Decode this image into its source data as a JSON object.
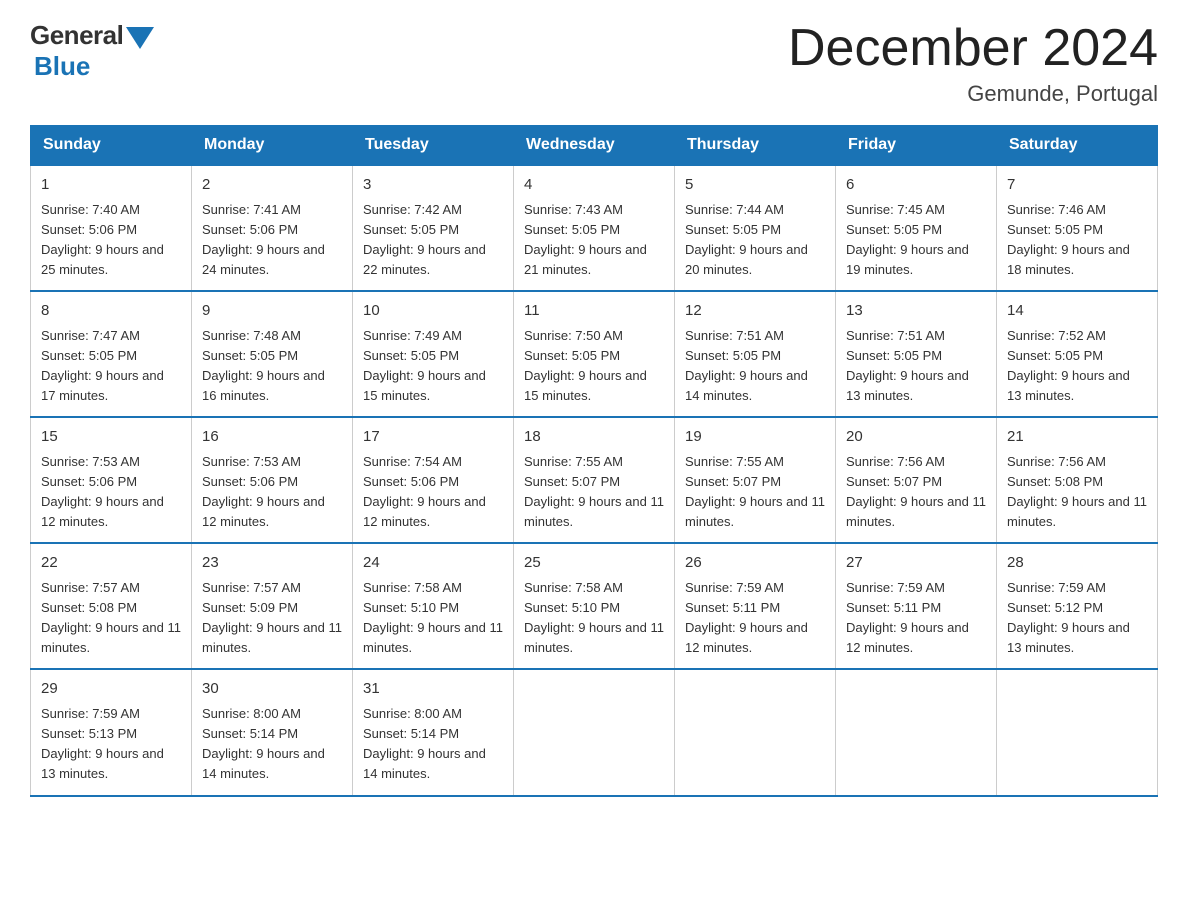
{
  "header": {
    "logo_general": "General",
    "logo_blue": "Blue",
    "month_title": "December 2024",
    "location": "Gemunde, Portugal"
  },
  "days_of_week": [
    "Sunday",
    "Monday",
    "Tuesday",
    "Wednesday",
    "Thursday",
    "Friday",
    "Saturday"
  ],
  "weeks": [
    [
      {
        "day": "1",
        "sunrise": "7:40 AM",
        "sunset": "5:06 PM",
        "daylight": "9 hours and 25 minutes."
      },
      {
        "day": "2",
        "sunrise": "7:41 AM",
        "sunset": "5:06 PM",
        "daylight": "9 hours and 24 minutes."
      },
      {
        "day": "3",
        "sunrise": "7:42 AM",
        "sunset": "5:05 PM",
        "daylight": "9 hours and 22 minutes."
      },
      {
        "day": "4",
        "sunrise": "7:43 AM",
        "sunset": "5:05 PM",
        "daylight": "9 hours and 21 minutes."
      },
      {
        "day": "5",
        "sunrise": "7:44 AM",
        "sunset": "5:05 PM",
        "daylight": "9 hours and 20 minutes."
      },
      {
        "day": "6",
        "sunrise": "7:45 AM",
        "sunset": "5:05 PM",
        "daylight": "9 hours and 19 minutes."
      },
      {
        "day": "7",
        "sunrise": "7:46 AM",
        "sunset": "5:05 PM",
        "daylight": "9 hours and 18 minutes."
      }
    ],
    [
      {
        "day": "8",
        "sunrise": "7:47 AM",
        "sunset": "5:05 PM",
        "daylight": "9 hours and 17 minutes."
      },
      {
        "day": "9",
        "sunrise": "7:48 AM",
        "sunset": "5:05 PM",
        "daylight": "9 hours and 16 minutes."
      },
      {
        "day": "10",
        "sunrise": "7:49 AM",
        "sunset": "5:05 PM",
        "daylight": "9 hours and 15 minutes."
      },
      {
        "day": "11",
        "sunrise": "7:50 AM",
        "sunset": "5:05 PM",
        "daylight": "9 hours and 15 minutes."
      },
      {
        "day": "12",
        "sunrise": "7:51 AM",
        "sunset": "5:05 PM",
        "daylight": "9 hours and 14 minutes."
      },
      {
        "day": "13",
        "sunrise": "7:51 AM",
        "sunset": "5:05 PM",
        "daylight": "9 hours and 13 minutes."
      },
      {
        "day": "14",
        "sunrise": "7:52 AM",
        "sunset": "5:05 PM",
        "daylight": "9 hours and 13 minutes."
      }
    ],
    [
      {
        "day": "15",
        "sunrise": "7:53 AM",
        "sunset": "5:06 PM",
        "daylight": "9 hours and 12 minutes."
      },
      {
        "day": "16",
        "sunrise": "7:53 AM",
        "sunset": "5:06 PM",
        "daylight": "9 hours and 12 minutes."
      },
      {
        "day": "17",
        "sunrise": "7:54 AM",
        "sunset": "5:06 PM",
        "daylight": "9 hours and 12 minutes."
      },
      {
        "day": "18",
        "sunrise": "7:55 AM",
        "sunset": "5:07 PM",
        "daylight": "9 hours and 11 minutes."
      },
      {
        "day": "19",
        "sunrise": "7:55 AM",
        "sunset": "5:07 PM",
        "daylight": "9 hours and 11 minutes."
      },
      {
        "day": "20",
        "sunrise": "7:56 AM",
        "sunset": "5:07 PM",
        "daylight": "9 hours and 11 minutes."
      },
      {
        "day": "21",
        "sunrise": "7:56 AM",
        "sunset": "5:08 PM",
        "daylight": "9 hours and 11 minutes."
      }
    ],
    [
      {
        "day": "22",
        "sunrise": "7:57 AM",
        "sunset": "5:08 PM",
        "daylight": "9 hours and 11 minutes."
      },
      {
        "day": "23",
        "sunrise": "7:57 AM",
        "sunset": "5:09 PM",
        "daylight": "9 hours and 11 minutes."
      },
      {
        "day": "24",
        "sunrise": "7:58 AM",
        "sunset": "5:10 PM",
        "daylight": "9 hours and 11 minutes."
      },
      {
        "day": "25",
        "sunrise": "7:58 AM",
        "sunset": "5:10 PM",
        "daylight": "9 hours and 11 minutes."
      },
      {
        "day": "26",
        "sunrise": "7:59 AM",
        "sunset": "5:11 PM",
        "daylight": "9 hours and 12 minutes."
      },
      {
        "day": "27",
        "sunrise": "7:59 AM",
        "sunset": "5:11 PM",
        "daylight": "9 hours and 12 minutes."
      },
      {
        "day": "28",
        "sunrise": "7:59 AM",
        "sunset": "5:12 PM",
        "daylight": "9 hours and 13 minutes."
      }
    ],
    [
      {
        "day": "29",
        "sunrise": "7:59 AM",
        "sunset": "5:13 PM",
        "daylight": "9 hours and 13 minutes."
      },
      {
        "day": "30",
        "sunrise": "8:00 AM",
        "sunset": "5:14 PM",
        "daylight": "9 hours and 14 minutes."
      },
      {
        "day": "31",
        "sunrise": "8:00 AM",
        "sunset": "5:14 PM",
        "daylight": "9 hours and 14 minutes."
      },
      null,
      null,
      null,
      null
    ]
  ]
}
